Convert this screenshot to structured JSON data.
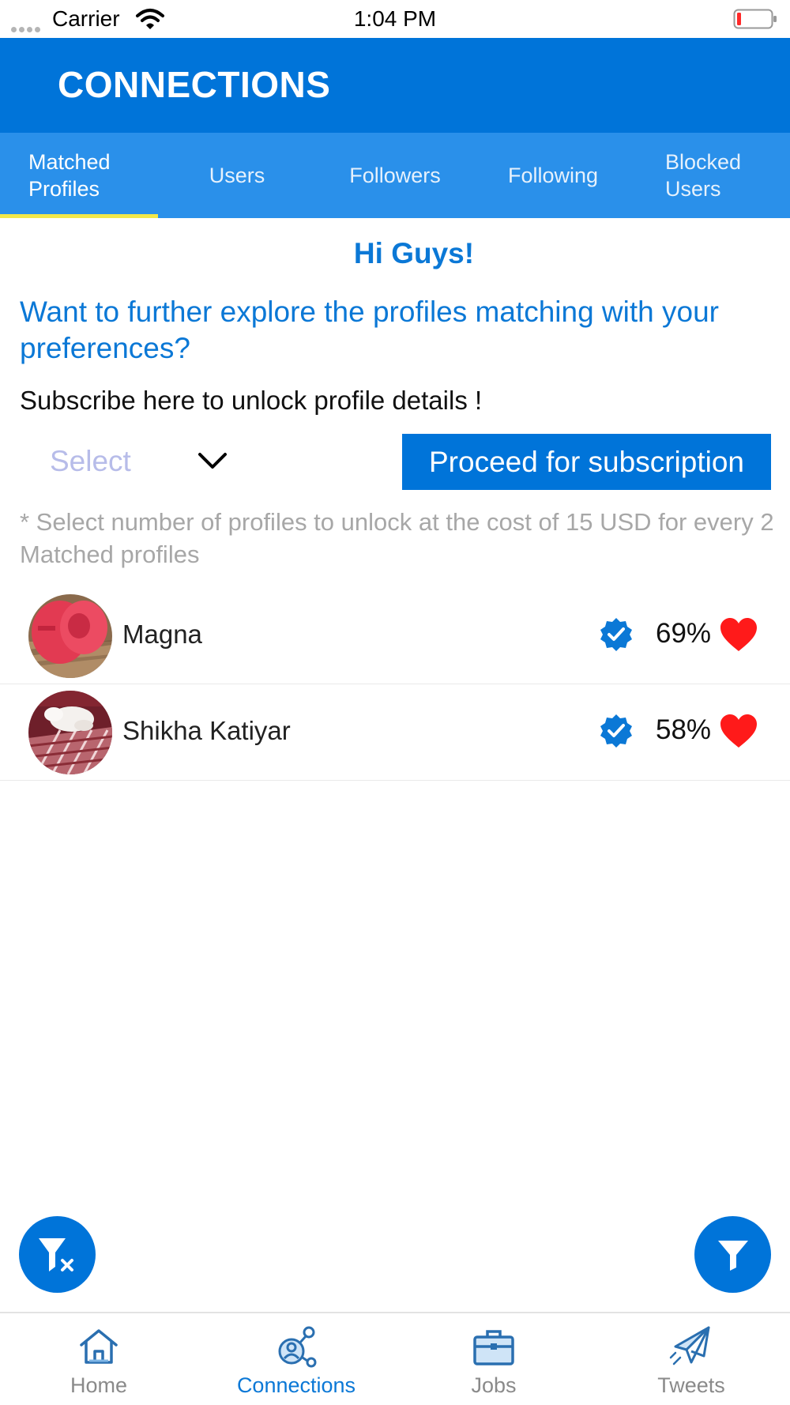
{
  "status_bar": {
    "carrier": "Carrier",
    "time": "1:04 PM"
  },
  "header": {
    "title": "CONNECTIONS"
  },
  "tabs": [
    {
      "label": "Matched\nProfiles",
      "active": true
    },
    {
      "label": "Users",
      "active": false
    },
    {
      "label": "Followers",
      "active": false
    },
    {
      "label": "Following",
      "active": false
    },
    {
      "label": "Blocked\nUsers",
      "active": false
    }
  ],
  "content": {
    "greeting": "Hi Guys!",
    "explore_text": "Want to further explore the profiles matching with your preferences?",
    "subscribe_text": "Subscribe here to unlock profile details !",
    "select_placeholder": "Select",
    "proceed_label": "Proceed for subscription",
    "note": "* Select number of profiles to unlock at the cost of 15 USD for every 2 Matched profiles"
  },
  "profiles": [
    {
      "name": "Magna",
      "match": "69%",
      "verified": true
    },
    {
      "name": "Shikha Katiyar",
      "match": "58%",
      "verified": true
    }
  ],
  "bottom_nav": [
    {
      "label": "Home",
      "icon": "home-icon",
      "active": false
    },
    {
      "label": "Connections",
      "icon": "connections-icon",
      "active": true
    },
    {
      "label": "Jobs",
      "icon": "briefcase-icon",
      "active": false
    },
    {
      "label": "Tweets",
      "icon": "paper-plane-icon",
      "active": false
    }
  ],
  "colors": {
    "primary": "#0074d9",
    "tab_bar": "#2a90ea",
    "tab_indicator": "#f2e84a",
    "heart": "#ff1a1a",
    "link_text": "#0b78d6"
  }
}
